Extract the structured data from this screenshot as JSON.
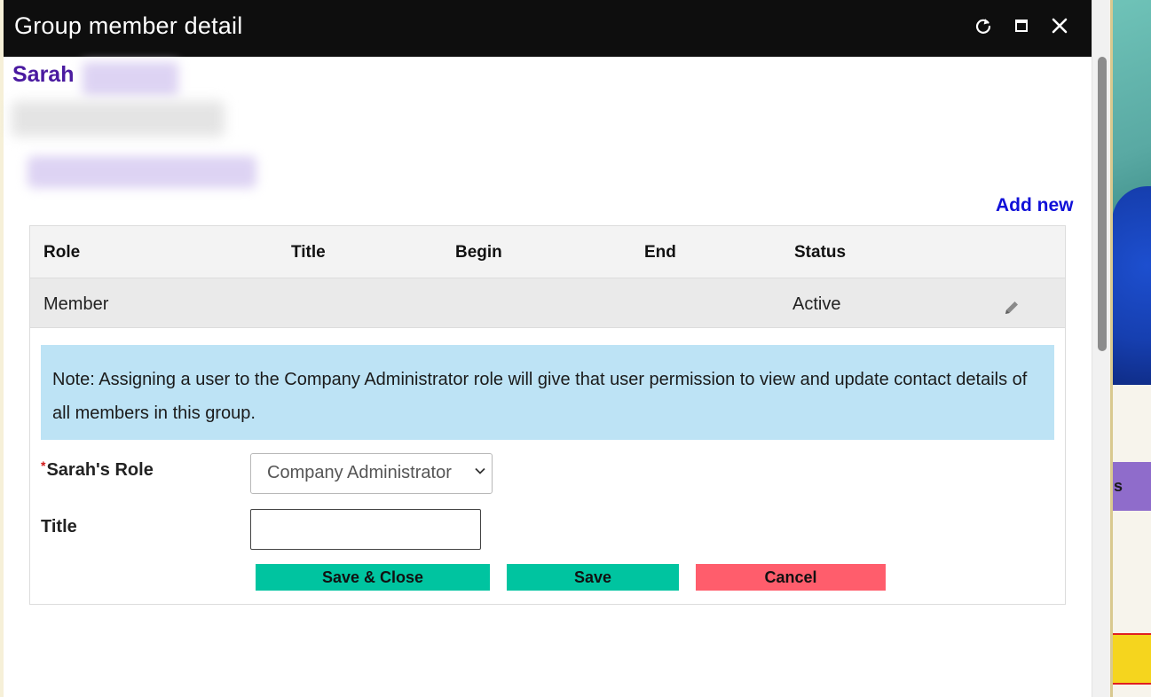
{
  "dialog": {
    "title": "Group member detail",
    "controls": {
      "refresh_icon": "refresh-icon",
      "maximize_icon": "maximize-icon",
      "close_icon": "close-icon"
    }
  },
  "member": {
    "first_name": "Sarah"
  },
  "actions": {
    "add_new": "Add new"
  },
  "table": {
    "headers": [
      "Role",
      "Title",
      "Begin",
      "End",
      "Status"
    ],
    "rows": [
      {
        "role": "Member",
        "title": "",
        "begin": "",
        "end": "",
        "status": "Active",
        "action_icon": "pencil-icon"
      }
    ]
  },
  "note": "Note: Assigning a user to the Company Administrator role will give that user permission to view and update contact details of all members in this group.",
  "form": {
    "role_required_mark": "*",
    "role_label": "Sarah's Role",
    "role_value": "Company Administrator",
    "title_label": "Title",
    "title_value": ""
  },
  "buttons": {
    "save_close": "Save & Close",
    "save": "Save",
    "cancel": "Cancel"
  },
  "background": {
    "purple_tab_text": "s"
  },
  "colors": {
    "titlebar": "#0e0e0e",
    "member_name": "#4a1aa0",
    "link": "#1010d8",
    "note_bg": "#bde3f5",
    "save_button": "#00c4a0",
    "cancel_button": "#ff5d6c",
    "required_mark": "#d01818"
  }
}
